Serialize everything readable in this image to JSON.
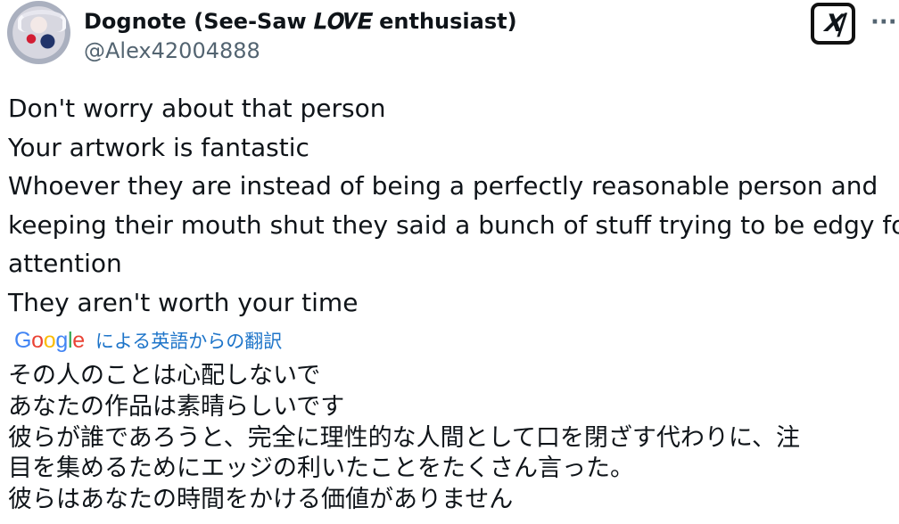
{
  "tweet": {
    "author_name": "Dognote (See-Saw 𝑳𝑶𝑽𝑬 enthusiast)",
    "author_handle": "@Alex42004888",
    "grok_icon": "grok-icon",
    "more_icon": "more-icon",
    "more_label": "···",
    "lines": [
      "Don't worry about that person",
      "Your artwork is fantastic",
      "Whoever they are instead of being a perfectly reasonable person and",
      "keeping their mouth shut they said a bunch of stuff trying to be edgy for",
      "attention",
      "They aren't worth your time"
    ]
  },
  "translation": {
    "provider_logo": [
      "G",
      "o",
      "o",
      "g",
      "l",
      "e"
    ],
    "logo_colors": [
      "#4285f4",
      "#ea4335",
      "#fbbc05",
      "#4285f4",
      "#34a853",
      "#ea4335"
    ],
    "label": "による英語からの翻訳",
    "lines": [
      "その人のことは心配しないで",
      "あなたの作品は素晴らしいです",
      "彼らが誰であろうと、完全に理性的な人間として口を閉ざす代わりに、注",
      "目を集めるためにエッジの利いたことをたくさん言った。",
      "彼らはあなたの時間をかける価値がありません"
    ]
  }
}
